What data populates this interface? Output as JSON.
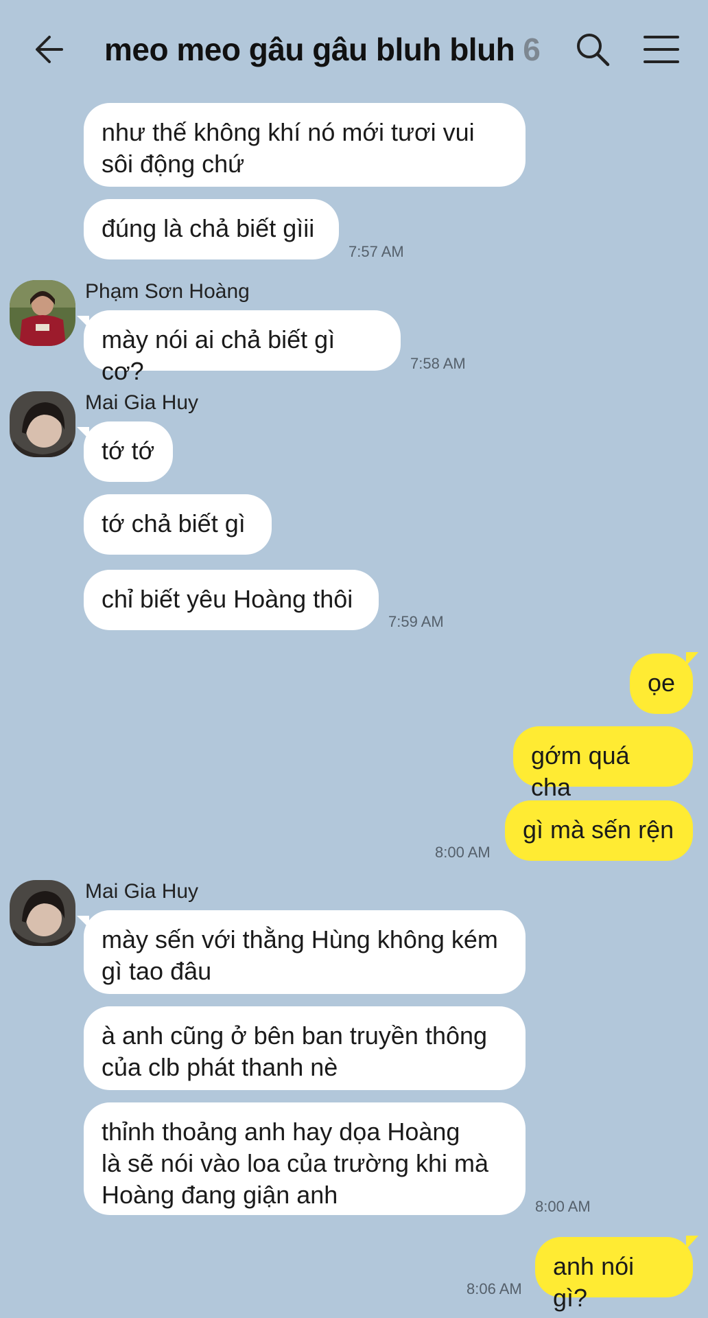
{
  "header": {
    "title": "meo meo gâu gâu bluh bluh",
    "member_count": "6",
    "back_icon": "arrow-left-icon",
    "search_icon": "search-icon",
    "menu_icon": "hamburger-menu-icon"
  },
  "colors": {
    "background": "#b2c7da",
    "incoming_bubble": "#ffffff",
    "outgoing_bubble": "#ffeb33",
    "timestamp": "#55606b"
  },
  "messages": {
    "m1": "như thế không khí nó mới tươi vui\nsôi động chứ",
    "m2": "đúng là chả biết gìii",
    "t1": "7:57 AM",
    "sender1": "Phạm Sơn Hoàng",
    "m3": "mày nói ai chả biết gì cơ?",
    "t2": "7:58 AM",
    "sender2": "Mai Gia Huy",
    "m4": "tớ tớ",
    "m5": "tớ chả biết gì",
    "m6": "chỉ biết yêu Hoàng thôi",
    "t3": "7:59 AM",
    "m7": "ọe",
    "m8": "gớm quá cha",
    "m9": "gì mà sến rện",
    "t4": "8:00 AM",
    "sender3": "Mai Gia Huy",
    "m10": "mày sến với thằng Hùng không kém\ngì tao đâu",
    "m11": "à anh cũng ở bên ban truyền thông\ncủa clb phát thanh nè",
    "m12": "thỉnh thoảng anh hay dọa Hoàng\nlà sẽ nói vào loa của trường khi mà\nHoàng đang giận anh",
    "t5": "8:00 AM",
    "m13": "anh nói gì?",
    "t6": "8:06 AM"
  }
}
